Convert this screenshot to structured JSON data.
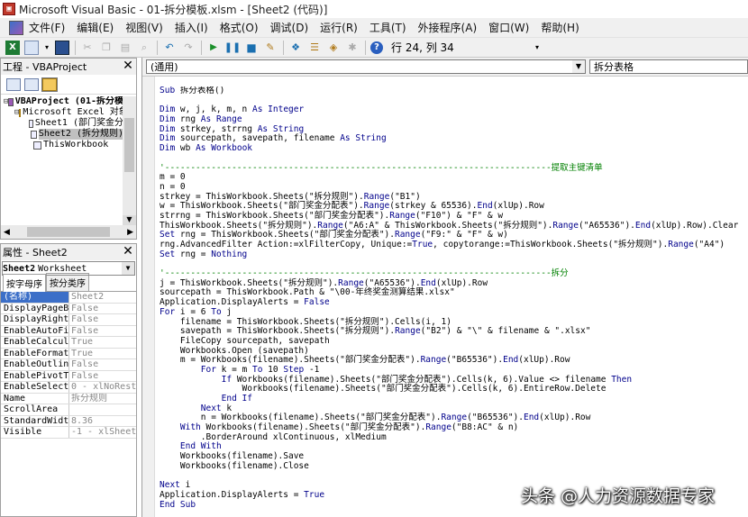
{
  "window": {
    "title": "Microsoft Visual Basic - 01-拆分模板.xlsm - [Sheet2 (代码)]"
  },
  "menu": {
    "items": [
      "文件(F)",
      "编辑(E)",
      "视图(V)",
      "插入(I)",
      "格式(O)",
      "调试(D)",
      "运行(R)",
      "工具(T)",
      "外接程序(A)",
      "窗口(W)",
      "帮助(H)"
    ]
  },
  "toolbar": {
    "cursor_position": "行 24, 列 34"
  },
  "project_pane": {
    "title": "工程 - VBAProject",
    "tree": [
      {
        "text": "VBAProject (01-拆分模",
        "depth": 0,
        "toggle": "⊟",
        "icon": "vba-project-icon",
        "bold": true,
        "selected": false
      },
      {
        "text": "Microsoft Excel 对象",
        "depth": 1,
        "toggle": "⊟",
        "icon": "folder-icon",
        "bold": false,
        "selected": false
      },
      {
        "text": "Sheet1 (部门奖金分",
        "depth": 2,
        "toggle": "",
        "icon": "sheet-icon",
        "bold": false,
        "selected": false
      },
      {
        "text": "Sheet2 (拆分规则)",
        "depth": 2,
        "toggle": "",
        "icon": "sheet-icon",
        "bold": false,
        "selected": true
      },
      {
        "text": "ThisWorkbook",
        "depth": 2,
        "toggle": "",
        "icon": "workbook-icon",
        "bold": false,
        "selected": false
      }
    ]
  },
  "properties_pane": {
    "title": "属性 - Sheet2",
    "object_name": "Sheet2",
    "object_type": "Worksheet",
    "tabs": [
      "按字母序",
      "按分类序"
    ],
    "rows": [
      {
        "name": "(名称)",
        "value": "Sheet2"
      },
      {
        "name": "DisplayPageBre",
        "value": "False"
      },
      {
        "name": "DisplayRightTo",
        "value": "False"
      },
      {
        "name": "EnableAutoFilt",
        "value": "False"
      },
      {
        "name": "EnableCalculat",
        "value": "True"
      },
      {
        "name": "EnableFormatCo",
        "value": "True"
      },
      {
        "name": "EnableOutlinin",
        "value": "False"
      },
      {
        "name": "EnablePivotTab",
        "value": "False"
      },
      {
        "name": "EnableSelectio",
        "value": "0 - xlNoRestr"
      },
      {
        "name": "Name",
        "value": "拆分规则"
      },
      {
        "name": "ScrollArea",
        "value": ""
      },
      {
        "name": "StandardWidth",
        "value": "8.36"
      },
      {
        "name": "Visible",
        "value": "-1 - xlSheetV"
      }
    ]
  },
  "code_window": {
    "object_combo": "(通用)",
    "procedure_combo": "拆分表格",
    "lines": [
      "Sub 拆分表格()",
      "",
      "Dim w, j, k, m, n As Integer",
      "Dim rng As Range",
      "Dim strkey, strrng As String",
      "Dim sourcepath, savepath, filename As String",
      "Dim wb As Workbook",
      "",
      "'---------------------------------------------------------------------------提取主键清单",
      "m = 0",
      "n = 0",
      "strkey = ThisWorkbook.Sheets(\"拆分规则\").Range(\"B1\")",
      "w = ThisWorkbook.Sheets(\"部门奖金分配表\").Range(strkey & 65536).End(xlUp).Row",
      "strrng = ThisWorkbook.Sheets(\"部门奖金分配表\").Range(\"F10\") & \"F\" & w",
      "ThisWorkbook.Sheets(\"拆分规则\").Range(\"A6:A\" & ThisWorkbook.Sheets(\"拆分规则\").Range(\"A65536\").End(xlUp).Row).Clear",
      "Set rng = ThisWorkbook.Sheets(\"部门奖金分配表\").Range(\"F9:\" & \"F\" & w)",
      "rng.AdvancedFilter Action:=xlFilterCopy, Unique:=True, copytorange:=ThisWorkbook.Sheets(\"拆分规则\").Range(\"A4\")",
      "Set rng = Nothing",
      "",
      "'---------------------------------------------------------------------------拆分",
      "j = ThisWorkbook.Sheets(\"拆分规则\").Range(\"A65536\").End(xlUp).Row",
      "sourcepath = ThisWorkbook.Path & \"\\00-年终奖金测算结果.xlsx\"",
      "Application.DisplayAlerts = False",
      "For i = 6 To j",
      "    filename = ThisWorkbook.Sheets(\"拆分规则\").Cells(i, 1)",
      "    savepath = ThisWorkbook.Sheets(\"拆分规则\").Range(\"B2\") & \"\\\" & filename & \".xlsx\"",
      "    FileCopy sourcepath, savepath",
      "    Workbooks.Open (savepath)",
      "    m = Workbooks(filename).Sheets(\"部门奖金分配表\").Range(\"B65536\").End(xlUp).Row",
      "        For k = m To 10 Step -1",
      "            If Workbooks(filename).Sheets(\"部门奖金分配表\").Cells(k, 6).Value <> filename Then",
      "                Workbooks(filename).Sheets(\"部门奖金分配表\").Cells(k, 6).EntireRow.Delete",
      "            End If",
      "        Next k",
      "        n = Workbooks(filename).Sheets(\"部门奖金分配表\").Range(\"B65536\").End(xlUp).Row",
      "    With Workbooks(filename).Sheets(\"部门奖金分配表\").Range(\"B8:AC\" & n)",
      "        .BorderAround xlContinuous, xlMedium",
      "    End With",
      "    Workbooks(filename).Save",
      "    Workbooks(filename).Close",
      "",
      "Next i",
      "Application.DisplayAlerts = True",
      "End Sub"
    ]
  },
  "watermark": "头条 @人力资源数据专家"
}
